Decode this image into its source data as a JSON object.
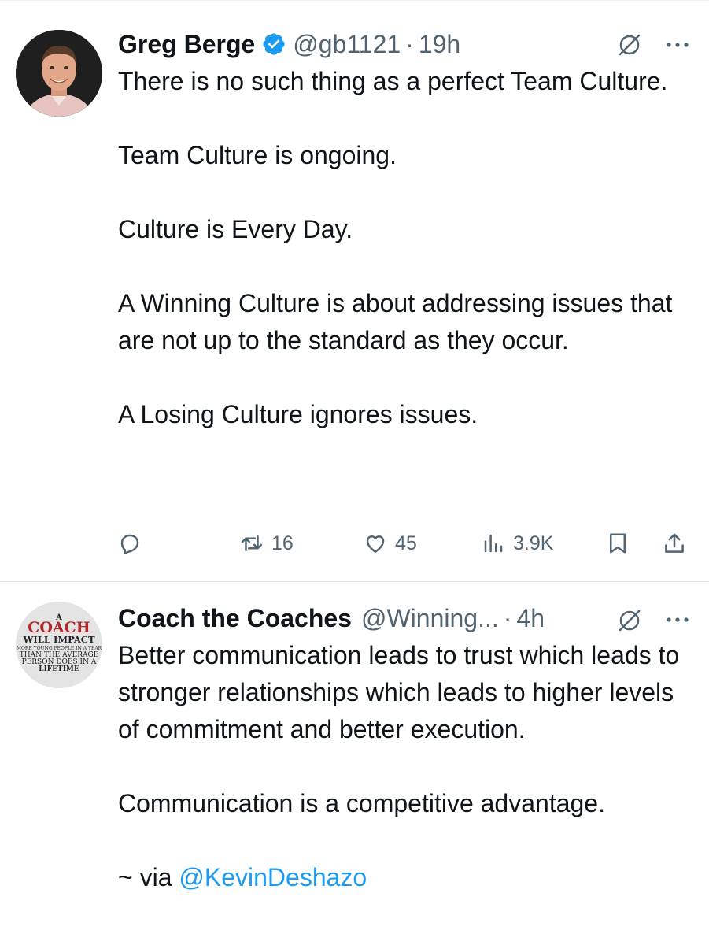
{
  "tweets": [
    {
      "author_name": "Greg Berge",
      "verified": true,
      "handle": "@gb1121",
      "separator": "·",
      "time": "19h",
      "paragraphs": [
        "There is no such thing as a perfect Team Culture.",
        "Team Culture is ongoing.",
        "Culture is Every Day.",
        "A Winning Culture is about addressing issues that are not up to the standard as they occur.",
        "A Losing Culture ignores issues."
      ],
      "actions": {
        "reply_count": "",
        "retweet_count": "16",
        "like_count": "45",
        "view_count": "3.9K"
      }
    },
    {
      "author_name": "Coach the Coaches",
      "handle": "@Winning...",
      "separator": "·",
      "time": "4h",
      "paragraphs": [
        "Better communication leads to trust which leads to stronger relationships which leads to higher levels of commitment and better execution.",
        "Communication is a competitive advantage."
      ],
      "via_prefix": "~ via ",
      "via_mention": "@KevinDeshazo",
      "avatar_text": {
        "line1": "A",
        "line2": "COACH",
        "line3": "WILL IMPACT",
        "line4": "MORE YOUNG PEOPLE IN A YEAR",
        "line5": "THAN THE AVERAGE",
        "line6": "PERSON DOES IN A",
        "line7": "LIFETIME"
      }
    }
  ],
  "colors": {
    "text": "#0f1419",
    "secondary": "#536471",
    "link": "#1d9bf0",
    "verified": "#1d9bf0"
  },
  "icons": [
    "grok-icon",
    "more-icon",
    "reply-icon",
    "retweet-icon",
    "like-icon",
    "views-icon",
    "bookmark-icon",
    "share-icon",
    "verified-badge-icon"
  ]
}
